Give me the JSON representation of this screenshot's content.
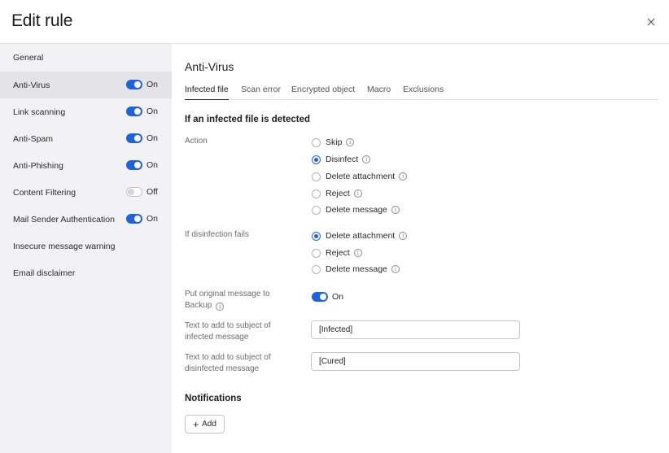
{
  "header": {
    "title": "Edit rule",
    "close_icon": "close-icon"
  },
  "sidebar": {
    "items": [
      {
        "label": "General",
        "toggle": null,
        "toggle_text": ""
      },
      {
        "label": "Anti-Virus",
        "toggle": "on",
        "toggle_text": "On"
      },
      {
        "label": "Link scanning",
        "toggle": "on",
        "toggle_text": "On"
      },
      {
        "label": "Anti-Spam",
        "toggle": "on",
        "toggle_text": "On"
      },
      {
        "label": "Anti-Phishing",
        "toggle": "on",
        "toggle_text": "On"
      },
      {
        "label": "Content Filtering",
        "toggle": "off",
        "toggle_text": "Off"
      },
      {
        "label": "Mail Sender Authentication",
        "toggle": "on",
        "toggle_text": "On"
      },
      {
        "label": "Insecure message warning",
        "toggle": null,
        "toggle_text": ""
      },
      {
        "label": "Email disclaimer",
        "toggle": null,
        "toggle_text": ""
      }
    ],
    "active_index": 1
  },
  "main": {
    "title": "Anti-Virus",
    "tabs": [
      {
        "label": "Infected file"
      },
      {
        "label": "Scan error"
      },
      {
        "label": "Encrypted object"
      },
      {
        "label": "Macro"
      },
      {
        "label": "Exclusions"
      }
    ],
    "active_tab": 0,
    "section_heading": "If an infected file is detected",
    "action": {
      "label": "Action",
      "options": [
        {
          "label": "Skip",
          "checked": false
        },
        {
          "label": "Disinfect",
          "checked": true
        },
        {
          "label": "Delete attachment",
          "checked": false
        },
        {
          "label": "Reject",
          "checked": false
        },
        {
          "label": "Delete message",
          "checked": false
        }
      ]
    },
    "disinfection_fails": {
      "label": "If disinfection fails",
      "options": [
        {
          "label": "Delete attachment",
          "checked": true
        },
        {
          "label": "Reject",
          "checked": false
        },
        {
          "label": "Delete message",
          "checked": false
        }
      ]
    },
    "backup": {
      "label_line1": "Put original message to",
      "label_line2": "Backup",
      "toggle": "on",
      "toggle_text": "On"
    },
    "infected_subject": {
      "label_line1": "Text to add to subject of",
      "label_line2": "infected message",
      "value": "[Infected]"
    },
    "disinfected_subject": {
      "label_line1": "Text to add to subject of",
      "label_line2": "disinfected message",
      "value": "[Cured]"
    },
    "notifications": {
      "heading": "Notifications",
      "add_label": "Add"
    }
  },
  "colors": {
    "accent": "#1d63e0",
    "sidebar_bg": "#f2f2f4",
    "sidebar_active": "#e4e4e8"
  }
}
